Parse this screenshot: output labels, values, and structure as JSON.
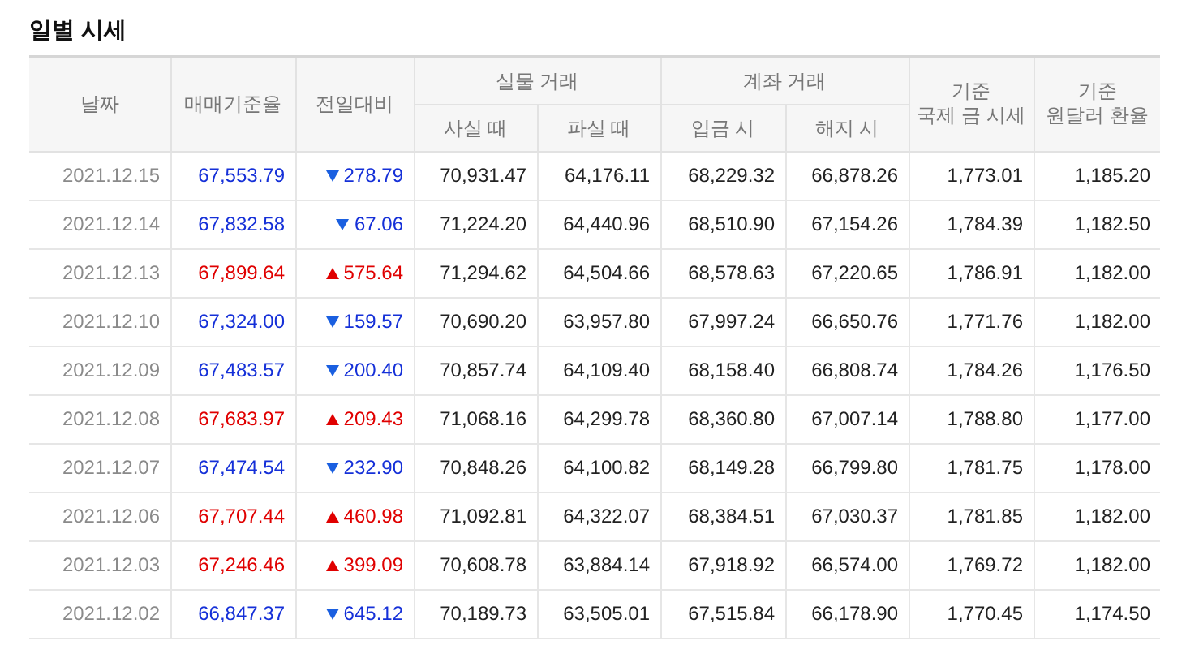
{
  "title": "일별 시세",
  "header": {
    "date": "날짜",
    "rate": "매매기준율",
    "change": "전일대비",
    "physical": {
      "label": "실물 거래",
      "buy": "사실 때",
      "sell": "파실 때"
    },
    "account": {
      "label": "계좌 거래",
      "deposit": "입금 시",
      "withdraw": "해지 시"
    },
    "intl": [
      "기준",
      "국제 금 시세"
    ],
    "fx": [
      "기준",
      "원달러 환율"
    ]
  },
  "rows": [
    {
      "date": "2021.12.15",
      "rate": "67,553.79",
      "kind": "down",
      "change": "278.79",
      "buy": "70,931.47",
      "sell": "64,176.11",
      "deposit": "68,229.32",
      "withdraw": "66,878.26",
      "intl": "1,773.01",
      "fx": "1,185.20"
    },
    {
      "date": "2021.12.14",
      "rate": "67,832.58",
      "kind": "down",
      "change": "67.06",
      "buy": "71,224.20",
      "sell": "64,440.96",
      "deposit": "68,510.90",
      "withdraw": "67,154.26",
      "intl": "1,784.39",
      "fx": "1,182.50"
    },
    {
      "date": "2021.12.13",
      "rate": "67,899.64",
      "kind": "up",
      "change": "575.64",
      "buy": "71,294.62",
      "sell": "64,504.66",
      "deposit": "68,578.63",
      "withdraw": "67,220.65",
      "intl": "1,786.91",
      "fx": "1,182.00"
    },
    {
      "date": "2021.12.10",
      "rate": "67,324.00",
      "kind": "down",
      "change": "159.57",
      "buy": "70,690.20",
      "sell": "63,957.80",
      "deposit": "67,997.24",
      "withdraw": "66,650.76",
      "intl": "1,771.76",
      "fx": "1,182.00"
    },
    {
      "date": "2021.12.09",
      "rate": "67,483.57",
      "kind": "down",
      "change": "200.40",
      "buy": "70,857.74",
      "sell": "64,109.40",
      "deposit": "68,158.40",
      "withdraw": "66,808.74",
      "intl": "1,784.26",
      "fx": "1,176.50"
    },
    {
      "date": "2021.12.08",
      "rate": "67,683.97",
      "kind": "up",
      "change": "209.43",
      "buy": "71,068.16",
      "sell": "64,299.78",
      "deposit": "68,360.80",
      "withdraw": "67,007.14",
      "intl": "1,788.80",
      "fx": "1,177.00"
    },
    {
      "date": "2021.12.07",
      "rate": "67,474.54",
      "kind": "down",
      "change": "232.90",
      "buy": "70,848.26",
      "sell": "64,100.82",
      "deposit": "68,149.28",
      "withdraw": "66,799.80",
      "intl": "1,781.75",
      "fx": "1,178.00"
    },
    {
      "date": "2021.12.06",
      "rate": "67,707.44",
      "kind": "up",
      "change": "460.98",
      "buy": "71,092.81",
      "sell": "64,322.07",
      "deposit": "68,384.51",
      "withdraw": "67,030.37",
      "intl": "1,781.85",
      "fx": "1,182.00"
    },
    {
      "date": "2021.12.03",
      "rate": "67,246.46",
      "kind": "up",
      "change": "399.09",
      "buy": "70,608.78",
      "sell": "63,884.14",
      "deposit": "67,918.92",
      "withdraw": "66,574.00",
      "intl": "1,769.72",
      "fx": "1,182.00"
    },
    {
      "date": "2021.12.02",
      "rate": "66,847.37",
      "kind": "down",
      "change": "645.12",
      "buy": "70,189.73",
      "sell": "63,505.01",
      "deposit": "67,515.84",
      "withdraw": "66,178.90",
      "intl": "1,770.45",
      "fx": "1,174.50"
    }
  ]
}
